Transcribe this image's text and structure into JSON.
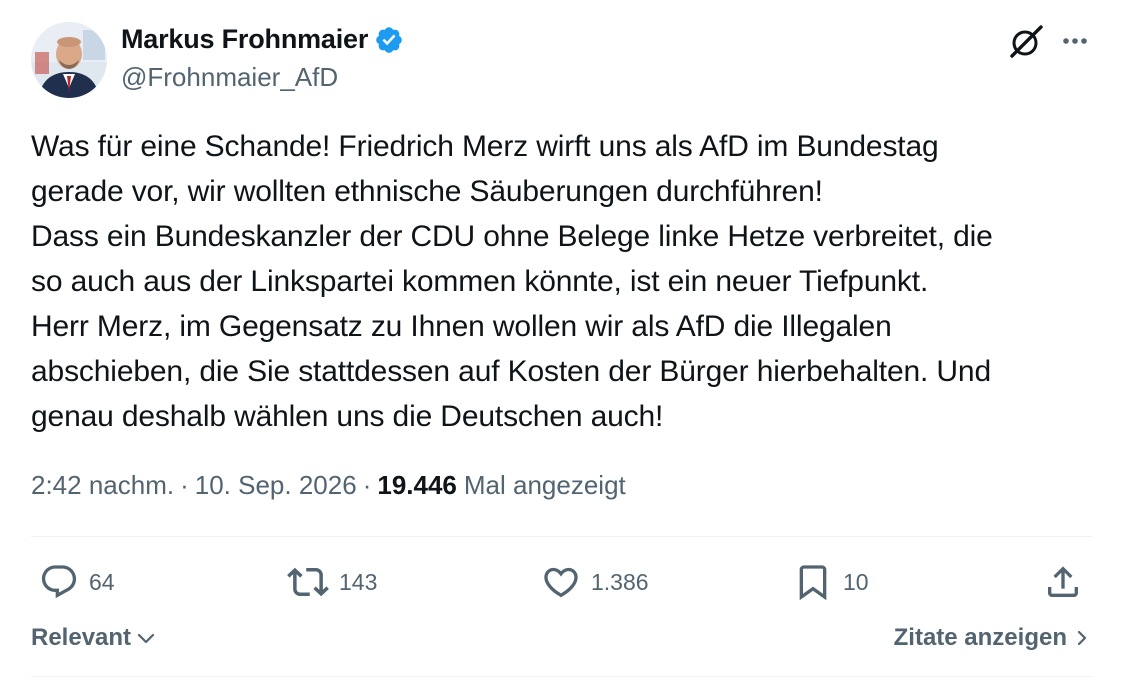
{
  "author": {
    "display_name": "Markus Frohnmaier",
    "handle": "@Frohnmaier_AfD",
    "verified": true
  },
  "tweet": {
    "lines": [
      "Was für eine Schande! Friedrich Merz wirft uns als AfD im Bundestag",
      "gerade vor, wir wollten ethnische Säuberungen durchführen!",
      "Dass ein Bundeskanzler der CDU ohne Belege linke Hetze verbreitet, die",
      "so auch aus der Linkspartei kommen könnte, ist ein neuer Tiefpunkt.",
      "Herr Merz, im Gegensatz zu Ihnen wollen wir als AfD die Illegalen",
      "abschieben, die Sie stattdessen auf Kosten der Bürger hierbehalten. Und",
      "genau deshalb wählen uns die Deutschen auch!"
    ]
  },
  "meta": {
    "time": "2:42 nachm.",
    "separator": "·",
    "date": "10. Sep. 2026",
    "views_count": "19.446",
    "views_label": "Mal angezeigt"
  },
  "actions": {
    "replies": "64",
    "reposts": "143",
    "likes": "1.386",
    "bookmarks": "10"
  },
  "footer": {
    "sort_label": "Relevant",
    "quotes_label": "Zitate anzeigen"
  },
  "colors": {
    "text": "#0f1419",
    "secondary": "#536471",
    "verified": "#1d9bf0",
    "divider": "#eff3f4"
  },
  "icons": [
    "grok-icon",
    "more-icon",
    "verified-badge-icon",
    "reply-icon",
    "repost-icon",
    "like-icon",
    "bookmark-icon",
    "share-icon",
    "chevron-down-icon",
    "chevron-right-icon"
  ]
}
